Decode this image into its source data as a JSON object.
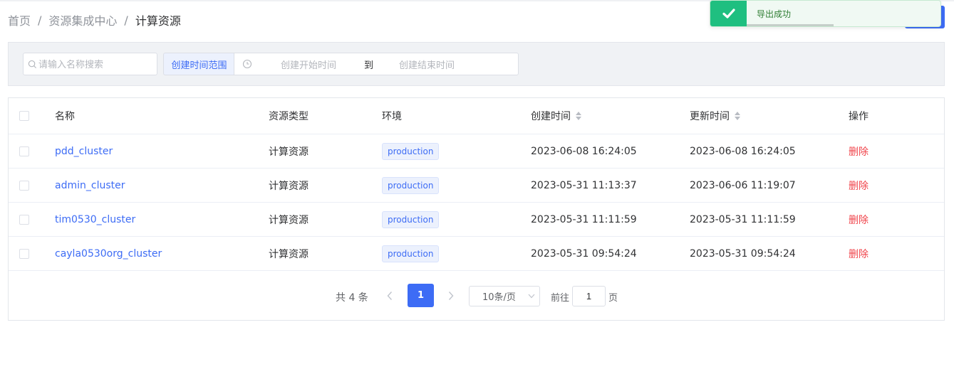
{
  "breadcrumb": {
    "items": [
      "首页",
      "资源集成中心",
      "计算资源"
    ],
    "separator": "/"
  },
  "toast": {
    "message": "导出成功",
    "icon": "check-icon",
    "color": "#1fbf80"
  },
  "filter": {
    "search_placeholder": "请输入名称搜索",
    "range_label": "创建时间范围",
    "start_placeholder": "创建开始时间",
    "range_separator": "到",
    "end_placeholder": "创建结束时间"
  },
  "table": {
    "columns": {
      "name": "名称",
      "type": "资源类型",
      "env": "环境",
      "created": "创建时间",
      "updated": "更新时间",
      "action": "操作"
    },
    "rows": [
      {
        "name": "pdd_cluster",
        "type": "计算资源",
        "env": "production",
        "created": "2023-06-08 16:24:05",
        "updated": "2023-06-08 16:24:05",
        "action": "删除"
      },
      {
        "name": "admin_cluster",
        "type": "计算资源",
        "env": "production",
        "created": "2023-05-31 11:13:37",
        "updated": "2023-06-06 11:19:07",
        "action": "删除"
      },
      {
        "name": "tim0530_cluster",
        "type": "计算资源",
        "env": "production",
        "created": "2023-05-31 11:11:59",
        "updated": "2023-05-31 11:11:59",
        "action": "删除"
      },
      {
        "name": "cayla0530org_cluster",
        "type": "计算资源",
        "env": "production",
        "created": "2023-05-31 09:54:24",
        "updated": "2023-05-31 09:54:24",
        "action": "删除"
      }
    ]
  },
  "pagination": {
    "total_text": "共 4 条",
    "current_page": "1",
    "page_size": "10条/页",
    "goto_label": "前往",
    "goto_value": "1",
    "goto_suffix": "页"
  },
  "colors": {
    "primary": "#3d6cf5",
    "danger": "#f0444b",
    "success": "#1fbf80"
  }
}
